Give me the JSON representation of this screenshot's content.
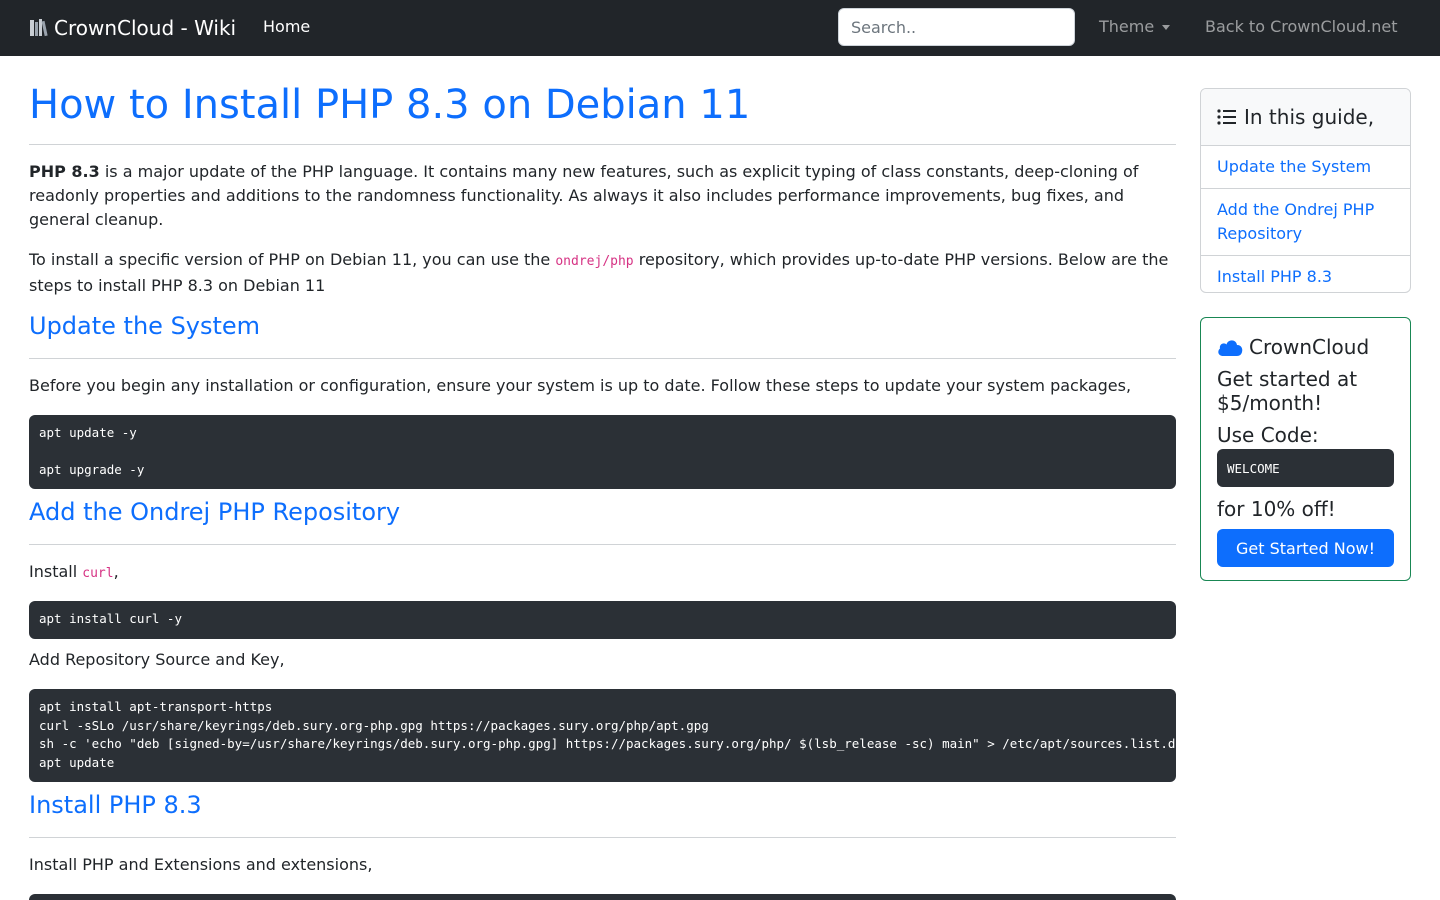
{
  "navbar": {
    "brand": "CrownCloud - Wiki",
    "home": "Home",
    "search_placeholder": "Search..",
    "theme": "Theme",
    "back": "Back to CrownCloud.net"
  },
  "article": {
    "title": "How to Install PHP 8.3 on Debian 11",
    "intro_bold": "PHP 8.3",
    "intro_rest": " is a major update of the PHP language. It contains many new features, such as explicit typing of class constants, deep-cloning of readonly properties and additions to the randomness functionality. As always it also includes performance improvements, bug fixes, and general cleanup.",
    "p2_before": "To install a specific version of PHP on Debian 11, you can use the ",
    "p2_code": "ondrej/php",
    "p2_after": " repository, which provides up-to-date PHP versions. Below are the steps to install PHP 8.3 on Debian 11",
    "sections": [
      {
        "heading": "Update the System",
        "text": "Before you begin any installation or configuration, ensure your system is up to date. Follow these steps to update your system packages,",
        "code": [
          "apt update -y",
          "",
          "apt upgrade -y"
        ]
      },
      {
        "heading": "Add the Ondrej PHP Repository",
        "text_before": "Install ",
        "text_code": "curl",
        "text_after": ",",
        "code": [
          "apt install curl -y"
        ],
        "text2": "Add Repository Source and Key,",
        "code2": [
          "apt install apt-transport-https",
          "curl -sSLo /usr/share/keyrings/deb.sury.org-php.gpg https://packages.sury.org/php/apt.gpg",
          "sh -c 'echo \"deb [signed-by=/usr/share/keyrings/deb.sury.org-php.gpg] https://packages.sury.org/php/ $(lsb_release -sc) main\" > /etc/apt/sources.list.d/php.list'",
          "apt update"
        ]
      },
      {
        "heading": "Install PHP 8.3",
        "text": "Install PHP and Extensions and extensions,"
      }
    ]
  },
  "toc": {
    "title": "In this guide,",
    "items": [
      "Update the System",
      "Add the Ondrej PHP Repository",
      "Install PHP 8.3"
    ]
  },
  "promo": {
    "title": "CrownCloud",
    "line1": "Get started at $5/month!",
    "line2": "Use Code:",
    "code": "WELCOME",
    "line3": "for 10% off!",
    "button": "Get Started Now!"
  },
  "colors": {
    "accent": "#0d6efd",
    "navbar": "#212529",
    "code_bg": "#2b3036",
    "inline_code": "#d63384",
    "promo_border": "#198754"
  }
}
